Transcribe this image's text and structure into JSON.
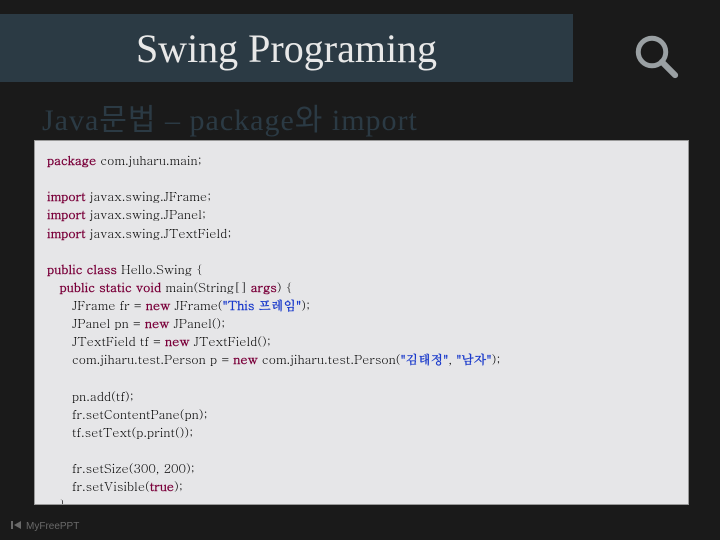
{
  "header": {
    "title": "Swing Programing"
  },
  "subtitle": "Java문법 – package와 import",
  "code": {
    "l1a": "package",
    "l1b": " com.juharu.main;",
    "l2a": "import",
    "l2b": " javax.swing.JFrame;",
    "l3a": "import",
    "l3b": " javax.swing.JPanel;",
    "l4a": "import",
    "l4b": " javax.swing.JTextField;",
    "l5a": "public class",
    "l5b": " Hello.Swing {",
    "l6a": "   public static void",
    "l6b": " main(String[] ",
    "l6c": "args",
    "l6d": ") {",
    "l7a": "      JFrame fr = ",
    "l7b": "new",
    "l7c": " JFrame(",
    "l7d": "\"This 프레임\"",
    "l7e": ");",
    "l8a": "      JPanel pn = ",
    "l8b": "new",
    "l8c": " JPanel();",
    "l9a": "      JTextField tf = ",
    "l9b": "new",
    "l9c": " JTextField();",
    "l10a": "      com.jiharu.test.Person p = ",
    "l10b": "new",
    "l10c": " com.jiharu.test.Person(",
    "l10d": "\"김태정\"",
    "l10e": ", ",
    "l10f": "\"남자\"",
    "l10g": ");",
    "l11": "      pn.add(tf);",
    "l12": "      fr.setContentPane(pn);",
    "l13": "      tf.setText(p.print());",
    "l14": "      fr.setSize(300, 200);",
    "l15a": "      fr.setVisible(",
    "l15b": "true",
    "l15c": ");",
    "l16": "   }",
    "l17": "}"
  },
  "footer": {
    "brand": "MyFreePPT"
  }
}
